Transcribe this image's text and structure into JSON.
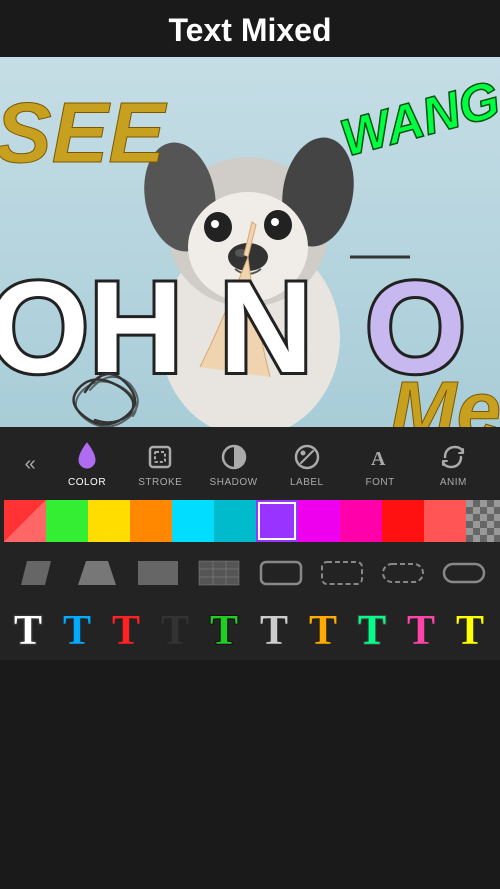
{
  "header": {
    "title": "Text Mixed"
  },
  "canvas": {
    "texts": {
      "see": "SEE",
      "wang": "WANG",
      "oh_no": "OH NO",
      "me": "Me"
    }
  },
  "toolbar": {
    "back_icon": "«",
    "tabs": [
      {
        "id": "color",
        "label": "COLOR",
        "icon": "droplet",
        "active": true
      },
      {
        "id": "stroke",
        "label": "STROKE",
        "icon": "stroke",
        "active": false
      },
      {
        "id": "shadow",
        "label": "SHADOW",
        "icon": "shadow",
        "active": false
      },
      {
        "id": "label",
        "label": "LABEL",
        "icon": "label",
        "active": false
      },
      {
        "id": "font",
        "label": "FONT",
        "icon": "font",
        "active": false
      },
      {
        "id": "anim",
        "label": "ANIM",
        "icon": "anim",
        "active": false
      }
    ]
  },
  "color_palette": [
    {
      "color": "#ff3333",
      "selected": false
    },
    {
      "color": "#ff6600",
      "selected": false
    },
    {
      "color": "#ffcc00",
      "selected": false
    },
    {
      "color": "#33cc33",
      "selected": false
    },
    {
      "color": "#00ccff",
      "selected": false
    },
    {
      "color": "#3333ff",
      "selected": false
    },
    {
      "color": "#9933ff",
      "selected": true
    },
    {
      "color": "#cc00cc",
      "selected": false
    },
    {
      "color": "#ff0099",
      "selected": false
    },
    {
      "color": "#ff3333",
      "selected": false
    },
    {
      "color": "#ff6666",
      "selected": false
    },
    {
      "color": "#checkerboard",
      "selected": false
    }
  ],
  "shapes": [
    {
      "type": "parallelogram-gray"
    },
    {
      "type": "trapezoid-gray"
    },
    {
      "type": "rectangle-gray"
    },
    {
      "type": "grid-gray"
    },
    {
      "type": "rounded-rect-gray"
    },
    {
      "type": "rounded-rect-dash"
    },
    {
      "type": "pill-dash"
    },
    {
      "type": "pill-gray"
    }
  ],
  "text_styles": [
    {
      "color": "#ffffff",
      "stroke": "#333"
    },
    {
      "color": "#00aaff",
      "stroke": "none"
    },
    {
      "color": "#ff2222",
      "stroke": "none"
    },
    {
      "color": "#333333",
      "stroke": "none"
    },
    {
      "color": "#22cc22",
      "stroke": "#111"
    },
    {
      "color": "#ffffff",
      "stroke": "#aaa"
    },
    {
      "color": "#ffaa00",
      "stroke": "none"
    },
    {
      "color": "#00ff88",
      "stroke": "#555"
    },
    {
      "color": "#ff44aa",
      "stroke": "none"
    },
    {
      "color": "#ffff00",
      "stroke": "none"
    }
  ]
}
